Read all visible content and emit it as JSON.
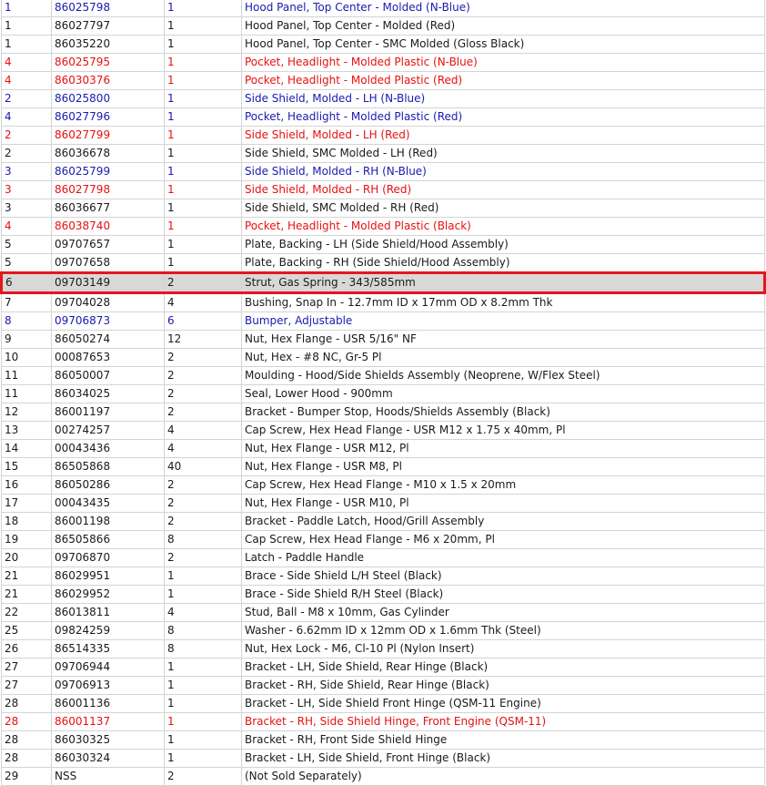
{
  "colors": {
    "blue": "#1a1ab0",
    "red": "#e81010",
    "black": "#1a1a1a",
    "highlight": "#e8141e",
    "selected_bg": "#d8d8d8"
  },
  "rows": [
    {
      "ref": "1",
      "part": "86025798",
      "qty": "1",
      "desc": "Hood Panel, Top Center - Molded (N-Blue)",
      "color": "blue"
    },
    {
      "ref": "1",
      "part": "86027797",
      "qty": "1",
      "desc": "Hood Panel, Top Center - Molded (Red)",
      "color": "black"
    },
    {
      "ref": "1",
      "part": "86035220",
      "qty": "1",
      "desc": "Hood Panel, Top Center - SMC Molded (Gloss Black)",
      "color": "black"
    },
    {
      "ref": "4",
      "part": "86025795",
      "qty": "1",
      "desc": "Pocket, Headlight - Molded Plastic (N-Blue)",
      "color": "red"
    },
    {
      "ref": "4",
      "part": "86030376",
      "qty": "1",
      "desc": "Pocket, Headlight - Molded Plastic (Red)",
      "color": "red"
    },
    {
      "ref": "2",
      "part": "86025800",
      "qty": "1",
      "desc": "Side Shield, Molded - LH (N-Blue)",
      "color": "blue"
    },
    {
      "ref": "4",
      "part": "86027796",
      "qty": "1",
      "desc": "Pocket, Headlight - Molded Plastic (Red)",
      "color": "blue"
    },
    {
      "ref": "2",
      "part": "86027799",
      "qty": "1",
      "desc": "Side Shield, Molded - LH (Red)",
      "color": "red"
    },
    {
      "ref": "2",
      "part": "86036678",
      "qty": "1",
      "desc": "Side Shield, SMC Molded - LH (Red)",
      "color": "black"
    },
    {
      "ref": "3",
      "part": "86025799",
      "qty": "1",
      "desc": "Side Shield, Molded - RH (N-Blue)",
      "color": "blue"
    },
    {
      "ref": "3",
      "part": "86027798",
      "qty": "1",
      "desc": "Side Shield, Molded - RH (Red)",
      "color": "red"
    },
    {
      "ref": "3",
      "part": "86036677",
      "qty": "1",
      "desc": "Side Shield, SMC Molded - RH (Red)",
      "color": "black"
    },
    {
      "ref": "4",
      "part": "86038740",
      "qty": "1",
      "desc": "Pocket, Headlight - Molded Plastic (Black)",
      "color": "red"
    },
    {
      "ref": "5",
      "part": "09707657",
      "qty": "1",
      "desc": "Plate, Backing - LH (Side Shield/Hood Assembly)",
      "color": "black"
    },
    {
      "ref": "5",
      "part": "09707658",
      "qty": "1",
      "desc": "Plate, Backing - RH (Side Shield/Hood Assembly)",
      "color": "black"
    },
    {
      "ref": "6",
      "part": "09703149",
      "qty": "2",
      "desc": "Strut, Gas Spring - 343/585mm",
      "color": "black",
      "selected": true
    },
    {
      "ref": "7",
      "part": "09704028",
      "qty": "4",
      "desc": "Bushing, Snap In - 12.7mm ID x 17mm OD x 8.2mm Thk",
      "color": "black"
    },
    {
      "ref": "8",
      "part": "09706873",
      "qty": "6",
      "desc": "Bumper, Adjustable",
      "color": "blue"
    },
    {
      "ref": "9",
      "part": "86050274",
      "qty": "12",
      "desc": "Nut, Hex Flange - USR 5/16\" NF",
      "color": "black"
    },
    {
      "ref": "10",
      "part": "00087653",
      "qty": "2",
      "desc": "Nut, Hex - #8 NC, Gr-5 Pl",
      "color": "black"
    },
    {
      "ref": "11",
      "part": "86050007",
      "qty": "2",
      "desc": "Moulding - Hood/Side Shields Assembly (Neoprene, W/Flex Steel)",
      "color": "black"
    },
    {
      "ref": "11",
      "part": "86034025",
      "qty": "2",
      "desc": "Seal, Lower Hood - 900mm",
      "color": "black"
    },
    {
      "ref": "12",
      "part": "86001197",
      "qty": "2",
      "desc": "Bracket - Bumper Stop, Hoods/Shields Assembly (Black)",
      "color": "black"
    },
    {
      "ref": "13",
      "part": "00274257",
      "qty": "4",
      "desc": "Cap Screw, Hex Head Flange - USR M12 x 1.75 x 40mm, Pl",
      "color": "black"
    },
    {
      "ref": "14",
      "part": "00043436",
      "qty": "4",
      "desc": "Nut, Hex Flange - USR M12, Pl",
      "color": "black"
    },
    {
      "ref": "15",
      "part": "86505868",
      "qty": "40",
      "desc": "Nut, Hex Flange - USR M8, Pl",
      "color": "black"
    },
    {
      "ref": "16",
      "part": "86050286",
      "qty": "2",
      "desc": "Cap Screw, Hex Head Flange - M10 x 1.5 x 20mm",
      "color": "black"
    },
    {
      "ref": "17",
      "part": "00043435",
      "qty": "2",
      "desc": "Nut, Hex Flange - USR M10, Pl",
      "color": "black"
    },
    {
      "ref": "18",
      "part": "86001198",
      "qty": "2",
      "desc": "Bracket - Paddle Latch, Hood/Grill Assembly",
      "color": "black"
    },
    {
      "ref": "19",
      "part": "86505866",
      "qty": "8",
      "desc": "Cap Screw, Hex Head Flange - M6 x 20mm, Pl",
      "color": "black"
    },
    {
      "ref": "20",
      "part": "09706870",
      "qty": "2",
      "desc": "Latch - Paddle Handle",
      "color": "black"
    },
    {
      "ref": "21",
      "part": "86029951",
      "qty": "1",
      "desc": "Brace - Side Shield L/H Steel (Black)",
      "color": "black"
    },
    {
      "ref": "21",
      "part": "86029952",
      "qty": "1",
      "desc": "Brace - Side Shield R/H Steel (Black)",
      "color": "black"
    },
    {
      "ref": "22",
      "part": "86013811",
      "qty": "4",
      "desc": "Stud, Ball - M8 x 10mm, Gas Cylinder",
      "color": "black"
    },
    {
      "ref": "25",
      "part": "09824259",
      "qty": "8",
      "desc": "Washer - 6.62mm ID x 12mm OD x 1.6mm Thk (Steel)",
      "color": "black"
    },
    {
      "ref": "26",
      "part": "86514335",
      "qty": "8",
      "desc": "Nut, Hex Lock - M6, Cl-10 Pl (Nylon Insert)",
      "color": "black"
    },
    {
      "ref": "27",
      "part": "09706944",
      "qty": "1",
      "desc": "Bracket - LH, Side Shield, Rear Hinge (Black)",
      "color": "black"
    },
    {
      "ref": "27",
      "part": "09706913",
      "qty": "1",
      "desc": "Bracket - RH, Side Shield, Rear Hinge (Black)",
      "color": "black"
    },
    {
      "ref": "28",
      "part": "86001136",
      "qty": "1",
      "desc": "Bracket - LH, Side Shield Front Hinge (QSM-11 Engine)",
      "color": "black"
    },
    {
      "ref": "28",
      "part": "86001137",
      "qty": "1",
      "desc": "Bracket - RH, Side Shield Hinge, Front Engine (QSM-11)",
      "color": "red"
    },
    {
      "ref": "28",
      "part": "86030325",
      "qty": "1",
      "desc": "Bracket - RH, Front Side Shield Hinge",
      "color": "black"
    },
    {
      "ref": "28",
      "part": "86030324",
      "qty": "1",
      "desc": "Bracket - LH, Side Shield, Front Hinge (Black)",
      "color": "black"
    },
    {
      "ref": "29",
      "part": "NSS",
      "qty": "2",
      "desc": "(Not Sold Separately)",
      "color": "black"
    }
  ]
}
